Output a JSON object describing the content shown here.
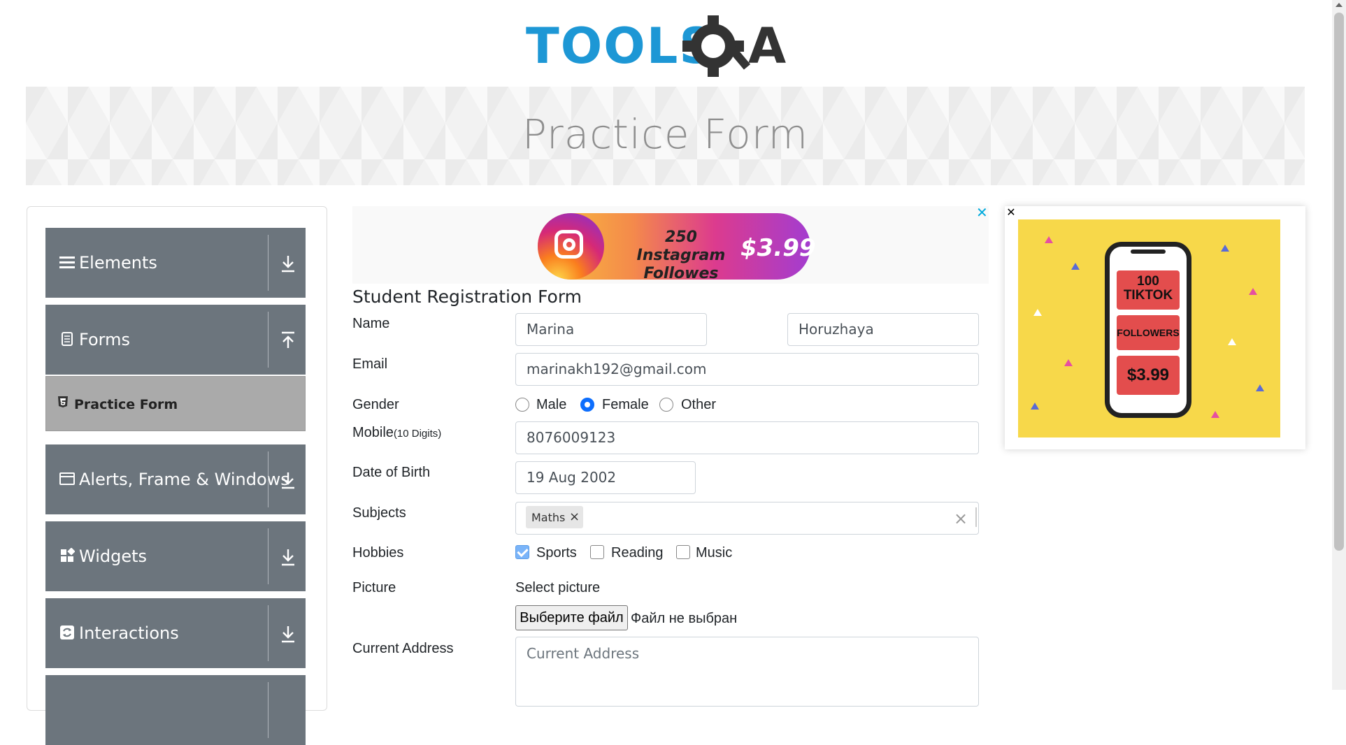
{
  "header": {
    "logo_text": "TOOLSQA"
  },
  "banner": {
    "title": "Practice Form"
  },
  "sidebar": {
    "groups": [
      {
        "label": "Elements",
        "icon": "hamburger-icon",
        "state": "collapsed"
      },
      {
        "label": "Forms",
        "icon": "document-icon",
        "state": "expanded"
      },
      {
        "label": "Alerts, Frame & Windows",
        "icon": "window-icon",
        "state": "collapsed"
      },
      {
        "label": "Widgets",
        "icon": "widgets-icon",
        "state": "collapsed"
      },
      {
        "label": "Interactions",
        "icon": "interactions-icon",
        "state": "collapsed"
      }
    ],
    "active_item": "Practice Form"
  },
  "ad_top": {
    "line1": "250 Instagram Followes",
    "price": "$3.99"
  },
  "ad_right": {
    "line1": "100 TIKTOK",
    "line2": "FOLLOWERS",
    "price": "$3.99"
  },
  "form": {
    "title": "Student Registration Form",
    "labels": {
      "name": "Name",
      "email": "Email",
      "gender": "Gender",
      "mobile": "Mobile",
      "mobile_hint": "(10 Digits)",
      "dob": "Date of Birth",
      "subjects": "Subjects",
      "hobbies": "Hobbies",
      "picture": "Picture",
      "address": "Current Address"
    },
    "first_name": "Marina",
    "last_name": "Horuzhaya",
    "email": "marinakh192@gmail.com",
    "gender_options": [
      "Male",
      "Female",
      "Other"
    ],
    "gender_selected": "Female",
    "mobile": "8076009123",
    "dob": "19 Aug 2002",
    "subjects": [
      "Maths"
    ],
    "hobbies": [
      {
        "label": "Sports",
        "checked": true
      },
      {
        "label": "Reading",
        "checked": false
      },
      {
        "label": "Music",
        "checked": false
      }
    ],
    "picture_label": "Select picture",
    "file_button": "Выберите файл",
    "file_status": "Файл не выбран",
    "address_placeholder": "Current Address"
  }
}
